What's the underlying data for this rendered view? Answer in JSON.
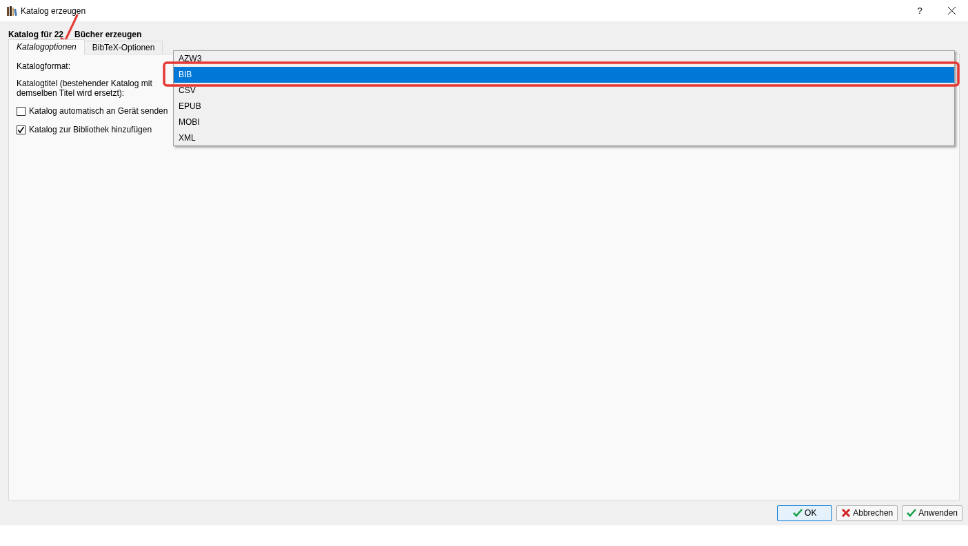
{
  "window": {
    "title": "Katalog erzeugen",
    "help": "?"
  },
  "heading": {
    "before": "Katalog für 22",
    "after": "Bücher erzeugen"
  },
  "tabs": [
    {
      "label": "Katalogoptionen",
      "selected": true
    },
    {
      "label": "BibTeX-Optionen",
      "selected": false
    }
  ],
  "fields": [
    {
      "kind": "label",
      "text": "Katalogformat:"
    },
    {
      "kind": "label",
      "text": "Katalogtitel (bestehender Katalog mit demselben Titel wird ersetzt):"
    },
    {
      "kind": "checkbox",
      "text": "Katalog automatisch an Gerät senden",
      "checked": false
    },
    {
      "kind": "checkbox",
      "text": "Katalog zur Bibliothek hinzufügen",
      "checked": true
    }
  ],
  "dropdown": {
    "options": [
      {
        "label": "AZW3",
        "selected": false
      },
      {
        "label": "BIB",
        "selected": true
      },
      {
        "label": "CSV",
        "selected": false
      },
      {
        "label": "EPUB",
        "selected": false
      },
      {
        "label": "MOBI",
        "selected": false
      },
      {
        "label": "XML",
        "selected": false
      }
    ]
  },
  "buttons": [
    {
      "label": "OK",
      "kind": "confirm",
      "default": true
    },
    {
      "label": "Abbrechen",
      "kind": "cancel",
      "default": false
    },
    {
      "label": "Anwenden",
      "kind": "confirm",
      "default": false
    }
  ]
}
